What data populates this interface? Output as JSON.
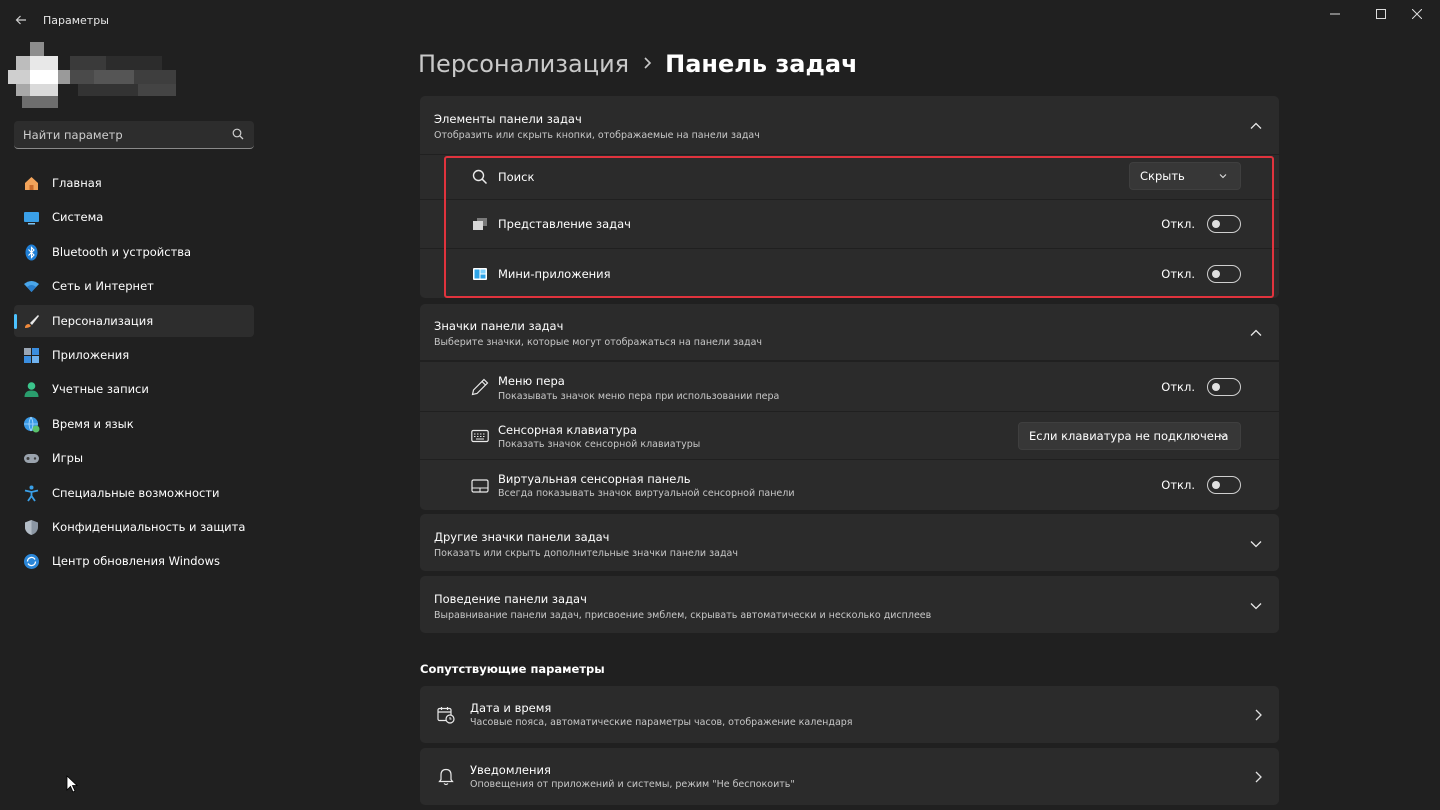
{
  "window": {
    "app_title": "Параметры"
  },
  "search": {
    "placeholder": "Найти параметр"
  },
  "sidebar": {
    "items": [
      {
        "label": "Главная",
        "icon": "home-icon"
      },
      {
        "label": "Система",
        "icon": "system-icon"
      },
      {
        "label": "Bluetooth и устройства",
        "icon": "bluetooth-icon"
      },
      {
        "label": "Сеть и Интернет",
        "icon": "wifi-icon"
      },
      {
        "label": "Персонализация",
        "icon": "brush-icon",
        "active": true
      },
      {
        "label": "Приложения",
        "icon": "apps-icon"
      },
      {
        "label": "Учетные записи",
        "icon": "account-icon"
      },
      {
        "label": "Время и язык",
        "icon": "globe-clock-icon"
      },
      {
        "label": "Игры",
        "icon": "gamepad-icon"
      },
      {
        "label": "Специальные возможности",
        "icon": "accessibility-icon"
      },
      {
        "label": "Конфиденциальность и защита",
        "icon": "shield-icon"
      },
      {
        "label": "Центр обновления Windows",
        "icon": "update-icon"
      }
    ],
    "accent_color": "#4cc2ff"
  },
  "breadcrumb": {
    "parent": "Персонализация",
    "current": "Панель задач"
  },
  "taskbar_items": {
    "title": "Элементы панели задач",
    "subtitle": "Отобразить или скрыть кнопки, отображаемые на панели задач",
    "rows": {
      "search": {
        "label": "Поиск",
        "value": "Скрыть"
      },
      "task_view": {
        "label": "Представление задач",
        "state": "Откл."
      },
      "widgets": {
        "label": "Мини-приложения",
        "state": "Откл."
      }
    }
  },
  "taskbar_icons": {
    "title": "Значки панели задач",
    "subtitle": "Выберите значки, которые могут отображаться на панели задач",
    "rows": {
      "pen_menu": {
        "label": "Меню пера",
        "sub": "Показывать значок меню пера при использовании пера",
        "state": "Откл."
      },
      "touch_keyboard": {
        "label": "Сенсорная клавиатура",
        "sub": "Показать значок сенсорной клавиатуры",
        "value": "Если клавиатура не подключена"
      },
      "virtual_touchpad": {
        "label": "Виртуальная сенсорная панель",
        "sub": "Всегда показывать значок виртуальной сенсорной панели",
        "state": "Откл."
      }
    }
  },
  "other_icons": {
    "title": "Другие значки панели задач",
    "subtitle": "Показать или скрыть дополнительные значки панели задач"
  },
  "behaviors": {
    "title": "Поведение панели задач",
    "subtitle": "Выравнивание панели задач, присвоение эмблем, скрывать автоматически и несколько дисплеев"
  },
  "related": {
    "title": "Сопутствующие параметры",
    "items": [
      {
        "title": "Дата и время",
        "sub": "Часовые пояса, автоматические параметры часов, отображение календаря"
      },
      {
        "title": "Уведомления",
        "sub": "Оповещения от приложений и системы, режим \"Не беспокоить\""
      }
    ]
  },
  "highlight_color": "#e0333d"
}
